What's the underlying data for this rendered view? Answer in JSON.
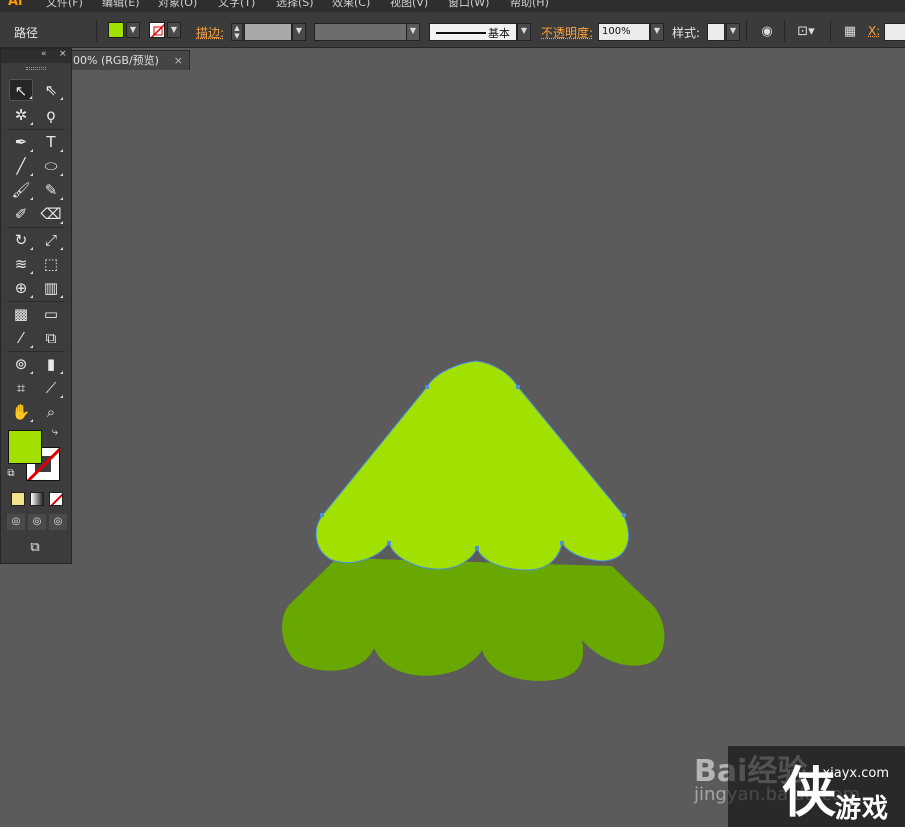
{
  "app": {
    "logo": "Ai",
    "menus": [
      "文件(F)",
      "编辑(E)",
      "对象(O)",
      "文字(T)",
      "选择(S)",
      "效果(C)",
      "视图(V)",
      "窗口(W)",
      "帮助(H)"
    ]
  },
  "control_bar": {
    "selection_label": "路径",
    "fill_color": "#a2e000",
    "stroke_label": "描边:",
    "stroke_style": "基本",
    "opacity_label": "不透明度:",
    "opacity_value": "100%",
    "style_label": "样式:",
    "x_label": "X:"
  },
  "document_tab": {
    "title": "00% (RGB/预览)",
    "close": "×"
  },
  "tool_panel": {
    "collapse": "«",
    "close": "×",
    "fill_color": "#a2e000",
    "stroke_color": "none"
  },
  "artwork": {
    "front_shape_color": "#a2e000",
    "back_shape_color": "#68a800",
    "selection_color": "#4a90e2"
  },
  "watermark": {
    "baidu": "Bai经验",
    "baidu_sub": "jingyan.baidu.com",
    "site": "xiayx.com",
    "brand": "游戏",
    "big_char": "侠"
  }
}
